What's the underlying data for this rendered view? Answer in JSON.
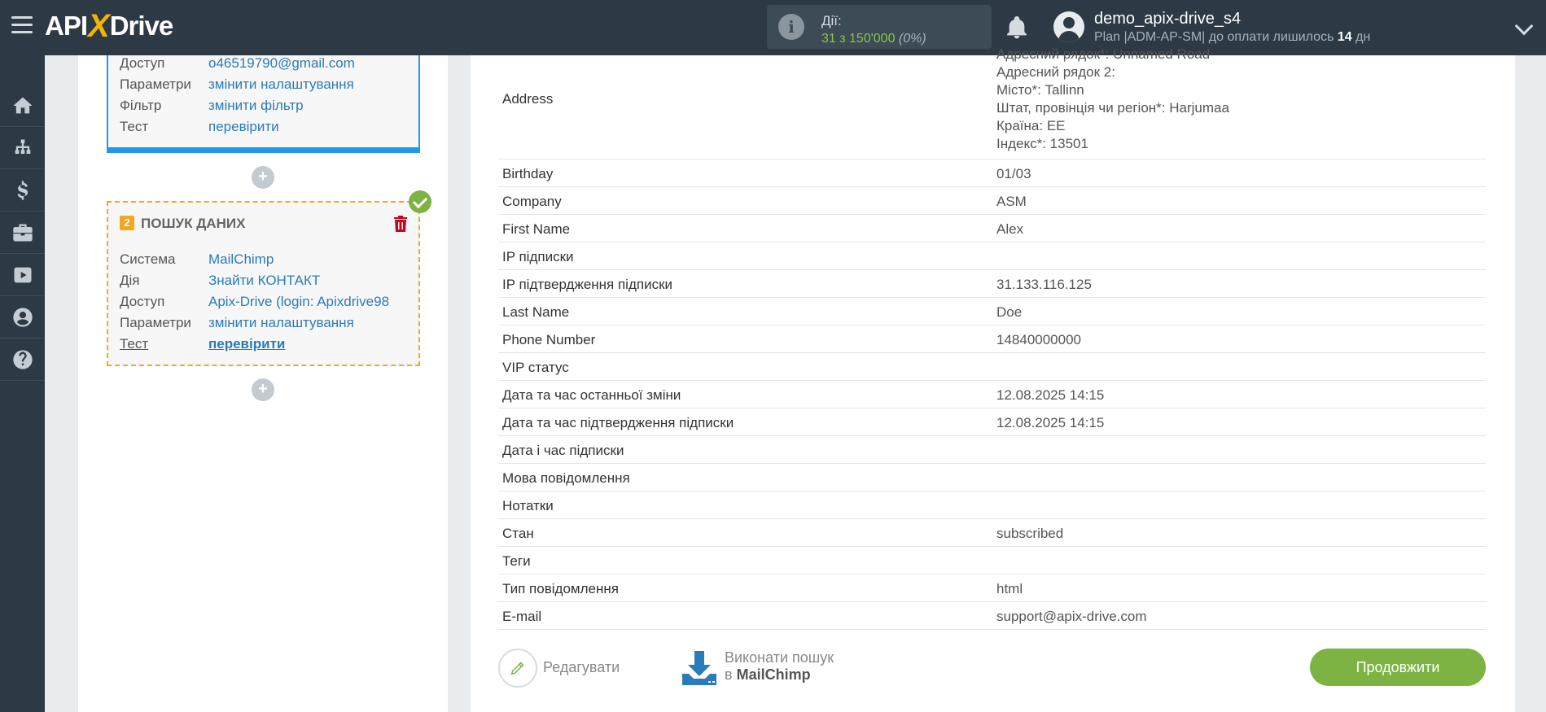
{
  "header": {
    "logo": {
      "part1": "API",
      "x": "X",
      "part2": "Drive"
    },
    "actions": {
      "label": "Дії:",
      "count": "31 з 150'000",
      "percent": "(0%)"
    },
    "user": {
      "name": "demo_apix-drive_s4",
      "plan_prefix": "Plan |ADM-AP-SM| до оплати лишилось ",
      "days": "14",
      "plan_suffix": " дн"
    }
  },
  "sidebar": {
    "items": [
      {
        "icon": "home-icon"
      },
      {
        "icon": "sitemap-icon"
      },
      {
        "icon": "dollar-icon"
      },
      {
        "icon": "briefcase-icon"
      },
      {
        "icon": "youtube-icon"
      },
      {
        "icon": "user-circle-icon"
      },
      {
        "icon": "help-icon"
      }
    ]
  },
  "card1": {
    "rows": [
      {
        "label": "Доступ",
        "value": "o46519790@gmail.com"
      },
      {
        "label": "Параметри",
        "value": "змінити налаштування"
      },
      {
        "label": "Фільтр",
        "value": "змінити фільтр"
      },
      {
        "label": "Тест",
        "value": "перевірити"
      }
    ]
  },
  "card2": {
    "number": "2",
    "title": "ПОШУК ДАНИХ",
    "rows": [
      {
        "label": "Система",
        "value": "MailChimp"
      },
      {
        "label": "Дія",
        "value": "Знайти КОНТАКТ"
      },
      {
        "label": "Доступ",
        "value": "Apix-Drive (login: Apixdrive98"
      },
      {
        "label": "Параметри",
        "value": "змінити налаштування"
      },
      {
        "label": "Тест",
        "value": "перевірити"
      }
    ]
  },
  "plus_label": "+",
  "address": {
    "label": "Address",
    "lines": [
      "Адресний рядок*: Unnamed Road",
      "Адресний рядок 2:",
      "Місто*: Tallinn",
      "Штат, провінція чи регіон*: Harjumaa",
      "Країна: EE",
      "Індекс*: 13501"
    ]
  },
  "rows": [
    {
      "key": "Birthday",
      "value": "01/03"
    },
    {
      "key": "Company",
      "value": "ASM"
    },
    {
      "key": "First Name",
      "value": "Alex"
    },
    {
      "key": "IP підписки",
      "value": ""
    },
    {
      "key": "IP підтвердження підписки",
      "value": "31.133.116.125"
    },
    {
      "key": "Last Name",
      "value": "Doe"
    },
    {
      "key": "Phone Number",
      "value": "14840000000"
    },
    {
      "key": "VIP статус",
      "value": ""
    },
    {
      "key": "Дата та час останньої зміни",
      "value": "12.08.2025 14:15"
    },
    {
      "key": "Дата та час підтвердження підписки",
      "value": "12.08.2025 14:15"
    },
    {
      "key": "Дата і час підписки",
      "value": ""
    },
    {
      "key": "Мова повідомлення",
      "value": ""
    },
    {
      "key": "Нотатки",
      "value": ""
    },
    {
      "key": "Стан",
      "value": "subscribed"
    },
    {
      "key": "Теги",
      "value": ""
    },
    {
      "key": "Тип повідомлення",
      "value": "html"
    },
    {
      "key": "E-mail",
      "value": "support@apix-drive.com"
    }
  ],
  "footer": {
    "edit_label": "Редагувати",
    "search_line1": "Виконати пошук",
    "search_prefix": "в ",
    "search_system": "MailChimp",
    "continue_label": "Продовжити"
  },
  "colors": {
    "header_bg": "#2d3a45",
    "accent_blue": "#2196f3",
    "accent_orange": "#f5a623",
    "accent_green": "#7cb342",
    "link": "#2b7bb9"
  }
}
